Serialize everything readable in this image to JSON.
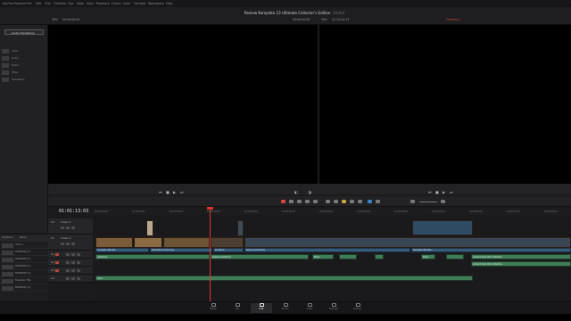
{
  "menu": {
    "items": [
      "DaVinci Resolve",
      "File",
      "Edit",
      "Trim",
      "Timeline",
      "Clip",
      "Mark",
      "View",
      "Playback",
      "Fusion",
      "Color",
      "Fairlight",
      "Workspace",
      "Help"
    ]
  },
  "project": {
    "title": "Review Komplete 13 Ultimate Collector's Edition",
    "subtitle": "Edited"
  },
  "viewer": {
    "left_zoom": "39%",
    "left_tc": "00:00:00:00",
    "center_tc": "00:00:00:00",
    "right_zoom": "39%",
    "right_tc": "01:13:44:15",
    "timeline_name": "Timeline 1"
  },
  "effects": {
    "search_label": "Audio Transitions",
    "items": [
      "Video",
      "Audio",
      "Fusion",
      "Titles",
      "Generators"
    ]
  },
  "timeline": {
    "timecode": "01:01:13:03",
    "ruler_ticks": [
      "01:00:00:00",
      "01:00:30:00",
      "01:01:00:00",
      "01:01:30:00",
      "01:02:00:00",
      "01:02:30:00",
      "01:03:00:00",
      "01:03:30:00",
      "01:04:00:00",
      "01:04:30:00",
      "01:05:00:00",
      "01:05:30:00",
      "01:06:00:00"
    ],
    "tracks": [
      {
        "id": "V2",
        "name": "Video 2"
      },
      {
        "id": "V1",
        "name": "Video 1"
      },
      {
        "id": "A1",
        "name": ""
      },
      {
        "id": "A2",
        "name": ""
      },
      {
        "id": "A3",
        "name": ""
      },
      {
        "id": "A4",
        "name": ""
      }
    ],
    "video_clips": [
      {
        "label": "Komplete Ultimate"
      },
      {
        "label": "Komplete 13 Unboxing"
      },
      {
        "label": "Kontakt 6"
      },
      {
        "label": "Native Instruments"
      },
      {
        "label": "Komplete Ultimate"
      }
    ],
    "audio_clips": [
      {
        "label": "Aufnahme"
      },
      {
        "label": "Bassline Aufnahme"
      },
      {
        "label": "Musik"
      },
      {
        "label": "Musik"
      },
      {
        "label": "Ambient track Intro Collection"
      },
      {
        "label": "Ambient track Intro Collection"
      },
      {
        "label": "Voice"
      }
    ]
  },
  "pool": {
    "header": [
      "Clip Name",
      "Name"
    ],
    "rows": [
      "Video 2",
      "KOMPLETE_13",
      "KOMPLETE_13",
      "KOMPLETE_13",
      "KOMPLETE_13",
      "Transition Title",
      "KOMPLETE_13"
    ]
  },
  "pages": [
    "Media",
    "Cut",
    "Edit",
    "Fusion",
    "Color",
    "Fairlight",
    "Deliver"
  ],
  "active_page": "Edit",
  "colors": {
    "playhead": "#e0352b",
    "video_clip": "#385b7a",
    "audio_clip": "#3f7d58",
    "timeline_marker": "#c0392b"
  }
}
